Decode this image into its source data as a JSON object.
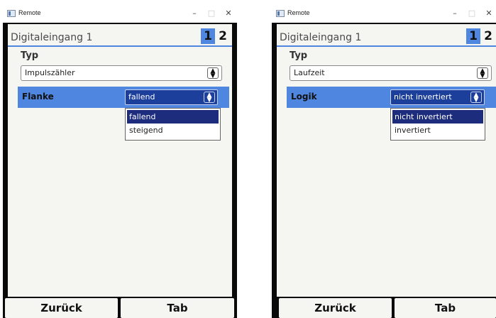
{
  "screens": [
    {
      "window_title": "Remote",
      "header_title": "Digitaleingang 1",
      "page_tabs": [
        "1",
        "2"
      ],
      "active_page": "1",
      "typ_label": "Typ",
      "typ_value": "Impulszähler",
      "row_label": "Flanke",
      "row_value": "fallend",
      "dropdown_options": [
        "fallend",
        "steigend"
      ],
      "selected_option": "fallend",
      "back_label": "Zurück",
      "tab_label": "Tab"
    },
    {
      "window_title": "Remote",
      "header_title": "Digitaleingang 1",
      "page_tabs": [
        "1",
        "2"
      ],
      "active_page": "1",
      "typ_label": "Typ",
      "typ_value": "Laufzeit",
      "row_label": "Logik",
      "row_value": "nicht invertiert",
      "dropdown_options": [
        "nicht invertiert",
        "invertiert"
      ],
      "selected_option": "nicht invertiert",
      "back_label": "Zurück",
      "tab_label": "Tab"
    }
  ],
  "icons": {
    "window_icon": "app-window-icon",
    "minimize": "minimize-icon",
    "maximize": "maximize-icon",
    "close": "close-icon",
    "select_arrow": "up-down-arrows-icon"
  },
  "colors": {
    "accent": "#4f86e0",
    "dropdown_selected": "#1d2c7c",
    "row_select_bg": "#1d3f9c",
    "panel_bg": "#f5f5f2",
    "frame": "#0a0a0a"
  }
}
